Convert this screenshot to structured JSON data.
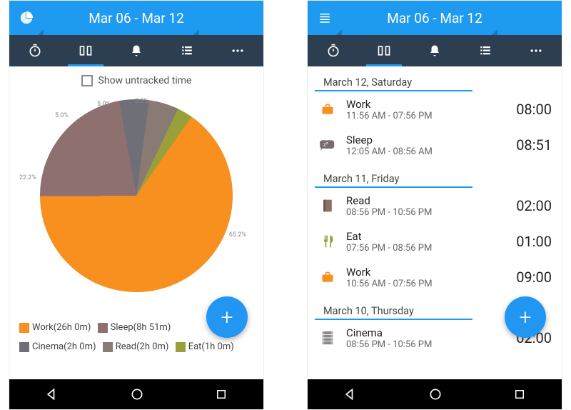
{
  "header": {
    "title": "Mar 06 - Mar 12"
  },
  "left": {
    "checkbox_label": "Show untracked time",
    "slice_labels": {
      "big": "65.2%",
      "s2": "22.2%",
      "s3": "5.0%",
      "s4": "5.0%",
      "s5": "2.5%"
    },
    "legend": [
      {
        "label": "Work(26h 0m)",
        "color": "#f7901e"
      },
      {
        "label": "Sleep(8h 51m)",
        "color": "#8f7070"
      },
      {
        "label": "Cinema(2h 0m)",
        "color": "#6f6f77"
      },
      {
        "label": "Read(2h 0m)",
        "color": "#8a7a74"
      },
      {
        "label": "Eat(1h 0m)",
        "color": "#99a039"
      }
    ]
  },
  "right": {
    "days": [
      {
        "header": "March 12, Saturday",
        "entries": [
          {
            "icon": "briefcase",
            "title": "Work",
            "range": "11:56 AM - 07:56 PM",
            "dur": "08:00"
          },
          {
            "icon": "sleep",
            "title": "Sleep",
            "range": "12:05 AM - 08:56 AM",
            "dur": "08:51"
          }
        ]
      },
      {
        "header": "March 11, Friday",
        "entries": [
          {
            "icon": "book",
            "title": "Read",
            "range": "08:56 PM - 10:56 PM",
            "dur": "02:00"
          },
          {
            "icon": "eat",
            "title": "Eat",
            "range": "07:56 PM - 08:56 PM",
            "dur": "01:00"
          },
          {
            "icon": "briefcase",
            "title": "Work",
            "range": "10:56 AM - 07:56 PM",
            "dur": "09:00"
          }
        ]
      },
      {
        "header": "March 10, Thursday",
        "entries": [
          {
            "icon": "film",
            "title": "Cinema",
            "range": "08:56 PM - 10:56 PM",
            "dur": "02:00"
          }
        ]
      }
    ]
  },
  "chart_data": {
    "type": "pie",
    "title": "",
    "series": [
      {
        "name": "Work",
        "value": 26.0,
        "unit": "hours",
        "percent": 65.2,
        "color": "#f7901e"
      },
      {
        "name": "Sleep",
        "value": 8.85,
        "unit": "hours",
        "percent": 22.2,
        "color": "#8f7070"
      },
      {
        "name": "Cinema",
        "value": 2.0,
        "unit": "hours",
        "percent": 5.0,
        "color": "#6f6f77"
      },
      {
        "name": "Read",
        "value": 2.0,
        "unit": "hours",
        "percent": 5.0,
        "color": "#8a7a74"
      },
      {
        "name": "Eat",
        "value": 1.0,
        "unit": "hours",
        "percent": 2.5,
        "color": "#99a039"
      }
    ]
  },
  "icons": {
    "briefcase_color": "#f7901e",
    "sleep_color": "#7a6b72",
    "book_color": "#8a7065",
    "eat_color": "#99a039",
    "film_color": "#888888"
  },
  "fab_label": "+"
}
